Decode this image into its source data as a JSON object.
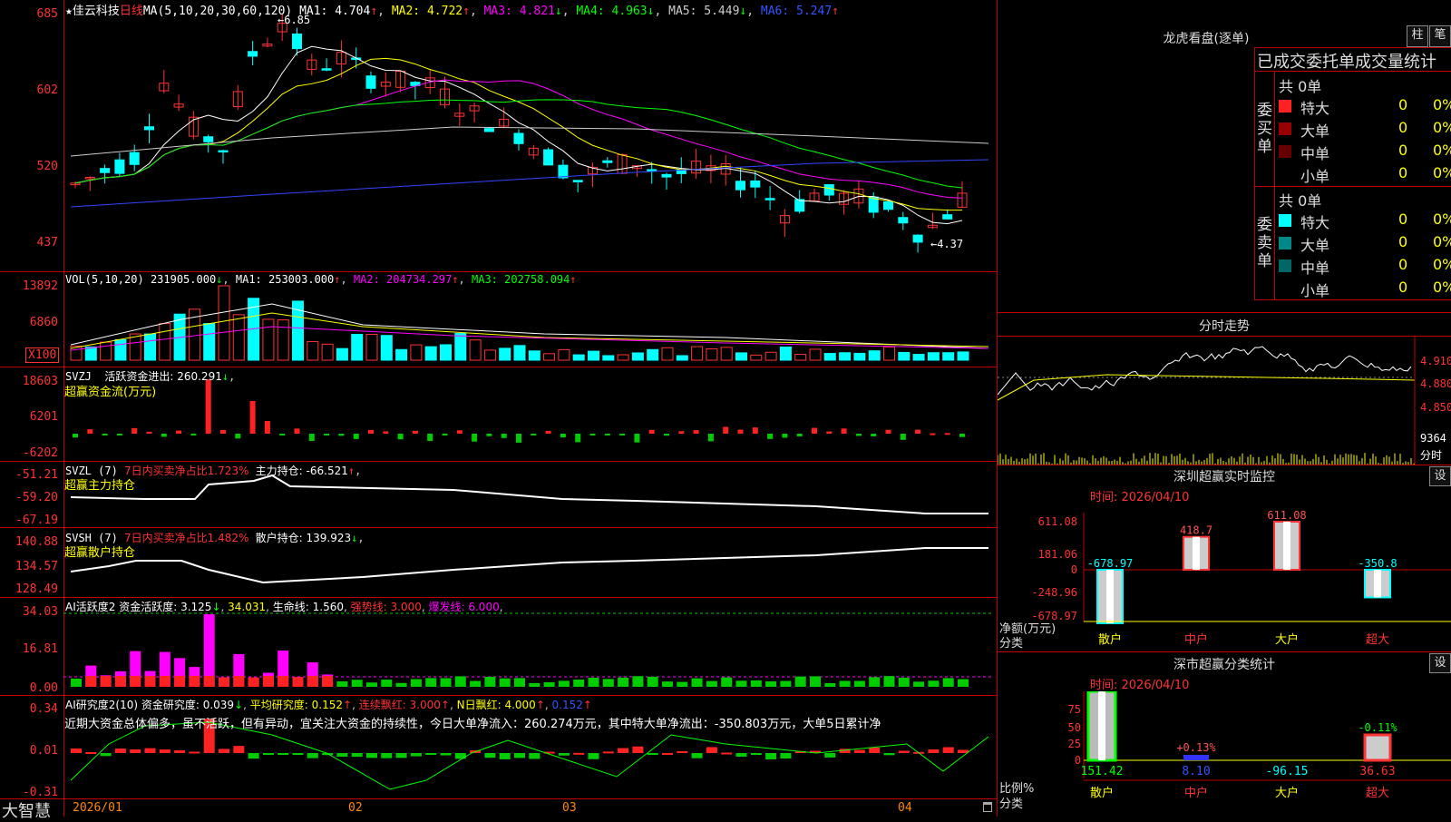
{
  "app": {
    "logo": "大智慧"
  },
  "kline": {
    "stock_name": "佳云科技",
    "period": "日线",
    "ma_param": "MA(5,10,20,30,60,120)",
    "ma1": "MA1: 4.704",
    "ma2": "MA2: 4.722",
    "ma3": "MA3: 4.821",
    "ma4": "MA4: 4.963",
    "ma5": "MA5: 5.449",
    "ma6": "MA6: 5.247",
    "axis": [
      "685",
      "602",
      "520",
      "437"
    ],
    "high_label": "6.85",
    "low_label": "4.37",
    "colors": {
      "up": "#ff3333",
      "down": "#00ffff",
      "ma1": "#ffffff",
      "ma2": "#ffff00",
      "ma3": "#ff00ff",
      "ma4": "#00ff00",
      "ma5": "#cccccc",
      "ma6": "#3344ff"
    }
  },
  "volume": {
    "title": "VOL(5,10,20)",
    "vol": "231905.000",
    "ma1": "MA1: 253003.000",
    "ma2": "MA2: 204734.297",
    "ma3": "MA3: 202758.094",
    "axis": [
      "13892",
      "6860"
    ],
    "unit": "X100"
  },
  "svzj": {
    "title": "SVZJ",
    "label": "活跃资金进出: 260.291",
    "subtitle": "超赢资金流(万元)",
    "axis": [
      "18603",
      "6201",
      "-6202"
    ]
  },
  "svzl": {
    "title": "SVZL (7)",
    "text1": "7日内买卖净占比1.723%",
    "text2": "主力持仓: -66.521",
    "subtitle": "超赢主力持仓",
    "axis": [
      "-51.21",
      "-59.20",
      "-67.19"
    ]
  },
  "svsh": {
    "title": "SVSH (7)",
    "text1": "7日内买卖净占比1.482%",
    "text2": "散户持仓: 139.923",
    "subtitle": "超赢散户持仓",
    "axis": [
      "140.88",
      "134.57",
      "128.49"
    ]
  },
  "ai_active": {
    "title": "AI活跃度2",
    "text1": "资金活跃度: 3.125",
    "text2": "34.031",
    "text3": "生命线: 1.560",
    "text4": "强势线: 3.000",
    "text5": "爆发线: 6.000",
    "axis": [
      "34.03",
      "16.81",
      "0.00"
    ]
  },
  "ai_research": {
    "title": "AI研究度2(10)",
    "text1": "资金研究度: 0.039",
    "text2": "平均研究度: 0.152",
    "text3": "连续飘红: 3.000",
    "text4": "N日飘红: 4.000",
    "text5": "0.152",
    "comment": "近期大资金总体偏多，虽不活跃，但有异动，宜关注大资金的持续性，今日大单净流入：260.274万元，其中特大单净流出：-350.803万元，大单5日累计净",
    "axis": [
      "0.34",
      "0.01",
      "-0.31"
    ]
  },
  "xaxis": {
    "labels": [
      "2026/01",
      "02",
      "03",
      "04"
    ]
  },
  "right": {
    "dragon_title": "龙虎看盘(逐单)",
    "btn_bar": "柱",
    "btn_pen": "笔",
    "stats_title": "已成交委托单成交量统计",
    "buy": {
      "side_label": "委买单",
      "total": "共 0单",
      "rows": [
        {
          "label": "特大",
          "v1": "0",
          "v2": "0%"
        },
        {
          "label": "大单",
          "v1": "0",
          "v2": "0%"
        },
        {
          "label": "中单",
          "v1": "0",
          "v2": "0%"
        },
        {
          "label": "小单",
          "v1": "0",
          "v2": "0%"
        }
      ]
    },
    "sell": {
      "side_label": "委卖单",
      "total": "共 0单",
      "rows": [
        {
          "label": "特大",
          "v1": "0",
          "v2": "0%"
        },
        {
          "label": "大单",
          "v1": "0",
          "v2": "0%"
        },
        {
          "label": "中单",
          "v1": "0",
          "v2": "0%"
        },
        {
          "label": "小单",
          "v1": "0",
          "v2": "0%"
        }
      ]
    },
    "intraday": {
      "title": "分时走势",
      "axis": [
        "4.910",
        "4.880",
        "4.850"
      ],
      "vol_label": "9364",
      "vol_unit": "分时"
    },
    "sz_monitor": {
      "title": "深圳超赢实时监控",
      "set_btn": "设",
      "time": "时间: 2026/04/10",
      "axis": [
        "611.08",
        "181.06",
        "0",
        "-248.96",
        "-678.97"
      ],
      "ylabel1": "净额(万元)",
      "ylabel2": "分类",
      "categories": [
        "散户",
        "中户",
        "大户",
        "超大"
      ],
      "values": [
        -678.97,
        418.7,
        611.08,
        -350.8
      ],
      "value_labels": [
        "-678.97",
        "418.7",
        "611.08",
        "-350.8"
      ]
    },
    "sz_class": {
      "title": "深市超赢分类统计",
      "set_btn": "设",
      "time": "时间: 2026/04/10",
      "axis": [
        "75",
        "50",
        "25",
        "0"
      ],
      "ylabel1": "比例%",
      "ylabel2": "分类",
      "categories": [
        "散户",
        "中户",
        "大户",
        "超大"
      ],
      "bottom_values": [
        "151.42",
        "8.10",
        "-96.15",
        "36.63"
      ],
      "top_labels": [
        "",
        "+0.13%",
        "",
        "-0.11%"
      ]
    }
  }
}
